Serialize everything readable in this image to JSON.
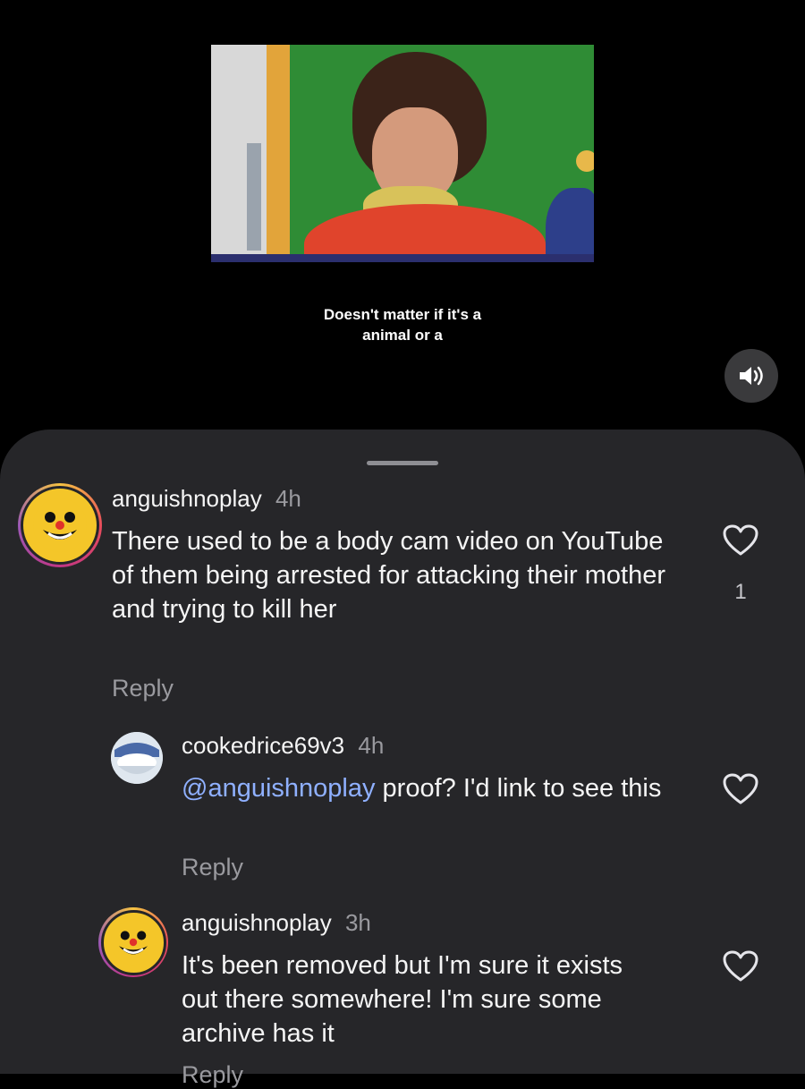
{
  "video": {
    "caption_line1": "Doesn't matter if it's a",
    "caption_line2": "animal or a"
  },
  "controls": {
    "volume_icon": "speaker-sound-icon"
  },
  "comments": [
    {
      "username": "anguishnoplay",
      "time": "4h",
      "text": "There used to be a body cam video on YouTube of them being arrested for attacking their mother and trying to kill her",
      "reply_label": "Reply",
      "likes": "1",
      "avatar": "smiley-clown-avatar"
    },
    {
      "username": "cookedrice69v3",
      "time": "4h",
      "mention": "@anguishnoplay",
      "text": " proof? I'd link to see this",
      "reply_label": "Reply",
      "avatar": "rice-bowl-avatar"
    },
    {
      "username": "anguishnoplay",
      "time": "3h",
      "text": "It's been removed but I'm sure it exists out there somewhere! I'm sure some archive has it",
      "reply_label": "Reply",
      "avatar": "smiley-clown-avatar"
    }
  ],
  "colors": {
    "sheet_background": "#262629",
    "mention": "#8fb0ff",
    "secondary_text": "#9a9a9f"
  }
}
